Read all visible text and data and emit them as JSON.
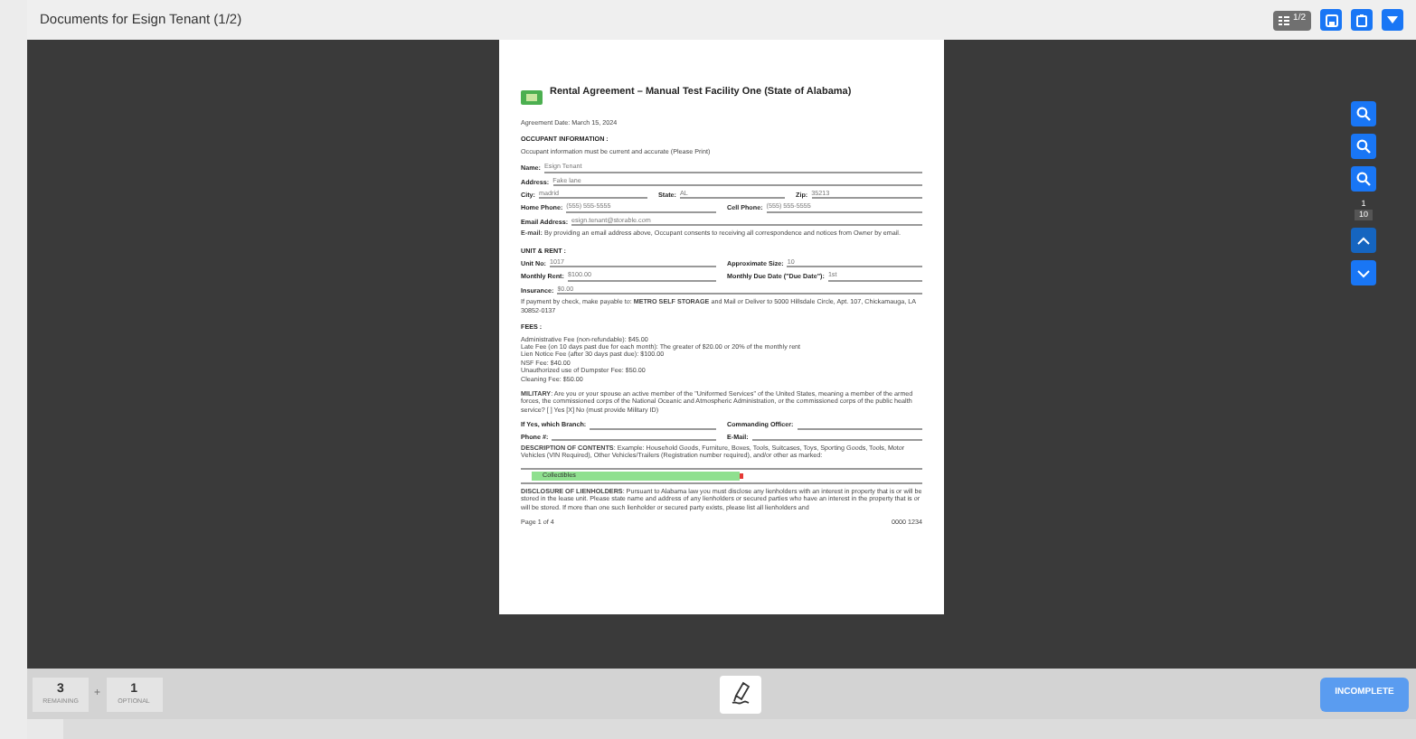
{
  "header": {
    "title": "Documents for Esign Tenant (1/2)",
    "page_toggle": "1/2"
  },
  "document": {
    "title": "Rental Agreement – Manual Test Facility One (State of Alabama)",
    "blocks": [
      {
        "kind": "text",
        "text": "Agreement Date: March 15, 2024"
      },
      {
        "kind": "heading",
        "text": "OCCUPANT INFORMATION :",
        "sub": "Occupant information must be current and accurate (Please Print)"
      },
      {
        "kind": "fields",
        "fields": [
          {
            "label": "Name:",
            "value": "Esign Tenant"
          }
        ]
      },
      {
        "kind": "fields",
        "fields": [
          {
            "label": "Address:",
            "value": "Fake lane"
          }
        ]
      },
      {
        "kind": "fields",
        "fields": [
          {
            "label": "City:",
            "value": "madrid"
          },
          {
            "label": "State:",
            "value": "AL"
          },
          {
            "label": "Zip:",
            "value": "35213"
          }
        ]
      },
      {
        "kind": "fields",
        "fields": [
          {
            "label": "Home Phone:",
            "value": "(555) 555-5555"
          },
          {
            "label": "Cell Phone:",
            "value": "(555) 555-5555"
          }
        ]
      },
      {
        "kind": "fields",
        "fields": [
          {
            "label": "Email Address:",
            "value": "esign.tenant@storable.com"
          }
        ]
      },
      {
        "kind": "text",
        "text": "**E-mail:** By providing an email address above, Occupant consents to receiving all correspondence and notices from Owner by email."
      },
      {
        "kind": "heading",
        "text": "UNIT & RENT :"
      },
      {
        "kind": "fields",
        "fields": [
          {
            "label": "Unit No:",
            "value": "1017"
          },
          {
            "label": "Approximate Size:",
            "value": "10"
          }
        ]
      },
      {
        "kind": "fields",
        "fields": [
          {
            "label": "Monthly Rent:",
            "value": "$100.00"
          },
          {
            "label": "Monthly Due Date (\"Due Date\"):",
            "value": "1st"
          }
        ]
      },
      {
        "kind": "fields",
        "fields": [
          {
            "label": "Insurance:",
            "value": "$0.00"
          }
        ]
      },
      {
        "kind": "text",
        "text": "If payment by check, make payable to: **METRO SELF STORAGE** and Mail or Deliver to 5000 Hillsdale Circle, Apt. 107, Chickamauga, LA 30852-0137"
      },
      {
        "kind": "heading",
        "text": "FEES :",
        "sub": "Administrative Fee (non-refundable): $45.00\nLate Fee (on 10 days past due for each month): The greater of $20.00 or 20% of the monthly rent\nLien Notice Fee (after 30 days past due): $100.00\nNSF Fee: $40.00\nUnauthorized use of Dumpster Fee: $50.00\nCleaning Fee: $50.00"
      },
      {
        "kind": "text",
        "text": "**MILITARY**: Are you or your spouse an active member of the \"Uniformed Services\" of the United States, meaning a member of the armed forces, the commissioned corps of the National Oceanic and Atmospheric Administration, or the commissioned corps of the public health service? [ ] Yes [X] No (must provide Military ID)"
      },
      {
        "kind": "fields",
        "fields": [
          {
            "label": "If Yes, which Branch:"
          },
          {
            "label": "Commanding Officer:"
          }
        ]
      },
      {
        "kind": "fields",
        "fields": [
          {
            "label": "Phone #:"
          },
          {
            "label": "E-Mail:"
          }
        ]
      },
      {
        "kind": "text",
        "text": "**DESCRIPTION OF CONTENTS**: Example: Household Goods, Furniture, Boxes, Tools, Suitcases, Toys, Sporting Goods, Tools, Motor Vehicles (VIN Required), Other Vehicles/Trailers (Registration number required), and/or other as marked:"
      },
      {
        "kind": "input",
        "value": "Collectibles",
        "required": true
      },
      {
        "kind": "text",
        "text": "**DISCLOSURE OF LIENHOLDERS**: Pursuant to Alabama law you must disclose any lienholders with an interest in property that is or will be stored in the lease unit. Please state name and address of any lienholders or secured parties who have an interest in the property that is or will be stored. If more than one such lienholder or secured party exists, please list all lienholders and"
      },
      {
        "kind": "footer",
        "left": "Page 1 of 4",
        "right": "0000 1234"
      }
    ]
  },
  "counters": [
    {
      "count": "3",
      "label": "REMAINING"
    },
    {
      "count": "1",
      "label": "OPTIONAL"
    }
  ],
  "counter_separator": "+",
  "page_indicator": {
    "current": "1",
    "total": "10"
  },
  "complete_button": "INCOMPLETE"
}
